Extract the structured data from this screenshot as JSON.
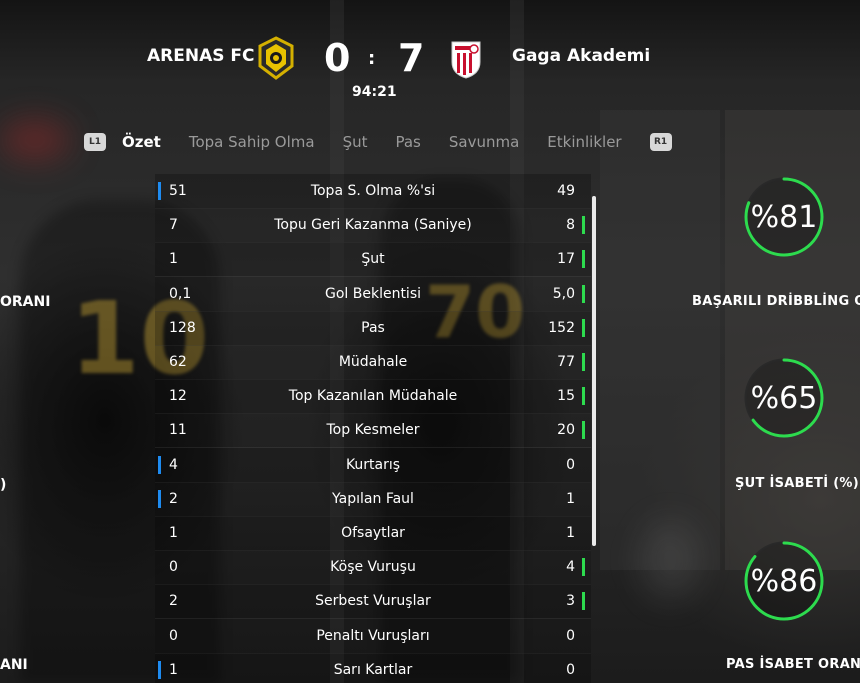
{
  "match": {
    "home_team": "ARENAS FC",
    "away_team": "Gaga Akademi",
    "home_score": "0",
    "separator": ":",
    "away_score": "7",
    "clock": "94:21"
  },
  "tabs": {
    "left_bumper": "L1",
    "right_bumper": "R1",
    "items": [
      "Özet",
      "Topa Sahip Olma",
      "Şut",
      "Pas",
      "Savunma",
      "Etkinlikler"
    ],
    "active": "Özet"
  },
  "stats": [
    {
      "label": "Topa S. Olma %'si",
      "home": "51",
      "away": "49",
      "leader": "home"
    },
    {
      "label": "Topu Geri Kazanma (Saniye)",
      "home": "7",
      "away": "8",
      "leader": "away"
    },
    {
      "label": "Şut",
      "home": "1",
      "away": "17",
      "leader": "away"
    },
    {
      "label": "Gol Beklentisi",
      "home": "0,1",
      "away": "5,0",
      "leader": "away"
    },
    {
      "label": "Pas",
      "home": "128",
      "away": "152",
      "leader": "away"
    },
    {
      "label": "Müdahale",
      "home": "62",
      "away": "77",
      "leader": "away"
    },
    {
      "label": "Top Kazanılan Müdahale",
      "home": "12",
      "away": "15",
      "leader": "away"
    },
    {
      "label": "Top Kesmeler",
      "home": "11",
      "away": "20",
      "leader": "away"
    },
    {
      "label": "Kurtarış",
      "home": "4",
      "away": "0",
      "leader": "home"
    },
    {
      "label": "Yapılan Faul",
      "home": "2",
      "away": "1",
      "leader": "home"
    },
    {
      "label": "Ofsaytlar",
      "home": "1",
      "away": "1",
      "leader": "none"
    },
    {
      "label": "Köşe Vuruşu",
      "home": "0",
      "away": "4",
      "leader": "away"
    },
    {
      "label": "Serbest Vuruşlar",
      "home": "2",
      "away": "3",
      "leader": "away"
    },
    {
      "label": "Penaltı Vuruşları",
      "home": "0",
      "away": "0",
      "leader": "none"
    },
    {
      "label": "Sarı Kartlar",
      "home": "1",
      "away": "0",
      "leader": "home"
    }
  ],
  "gauges": [
    {
      "value": "%81",
      "fraction": 0.81,
      "label": "BAŞARILI DRİBBLİNG O"
    },
    {
      "value": "%65",
      "fraction": 0.65,
      "label": "ŞUT İSABETİ (%)"
    },
    {
      "value": "%86",
      "fraction": 0.86,
      "label": "PAS İSABET ORAN"
    }
  ],
  "left_labels": [
    "ORANI",
    ")",
    "ANI"
  ],
  "colors": {
    "home_marker": "#1e8bf0",
    "away_marker": "#2ddb4e",
    "gauge_fill": "#2ddb4e"
  }
}
